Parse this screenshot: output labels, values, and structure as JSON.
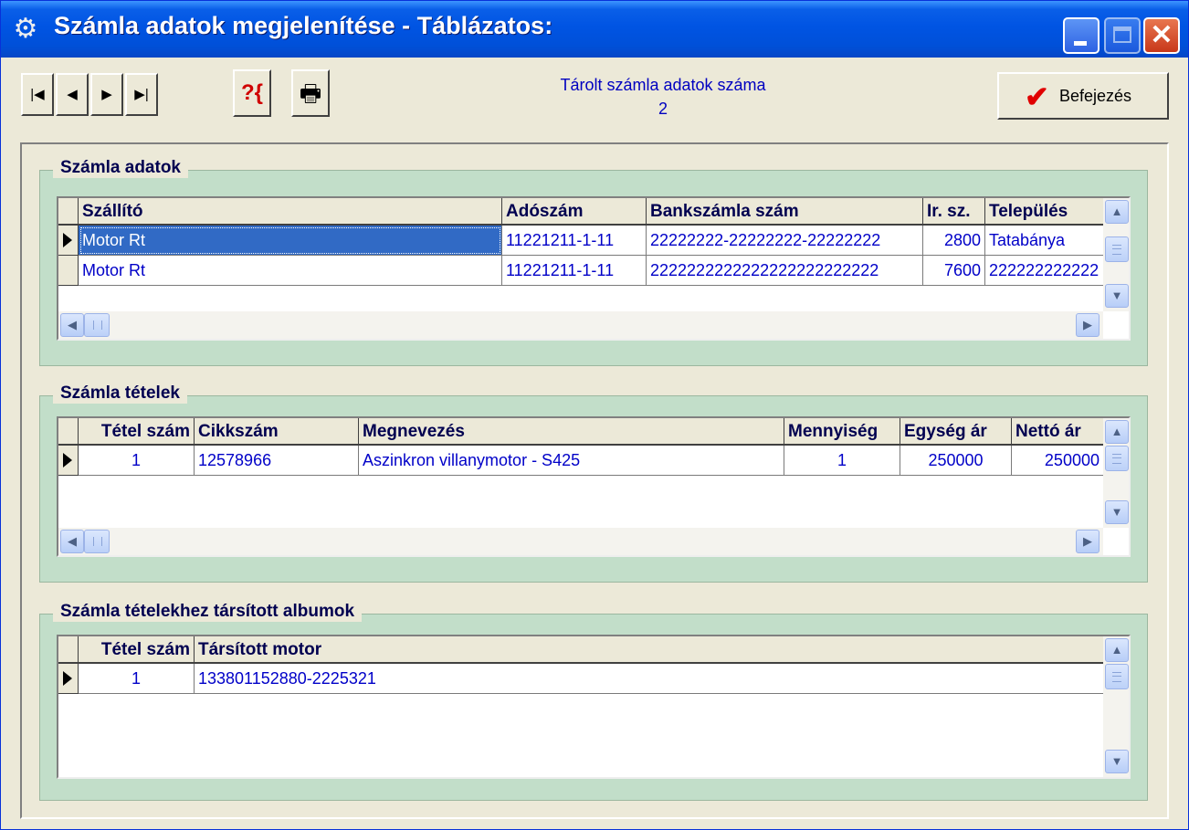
{
  "window": {
    "title": "Számla adatok megjelenítése - Táblázatos:",
    "icon": "gear-icon"
  },
  "toolbar": {
    "first_glyph": "|◀",
    "prev_glyph": "◀",
    "next_glyph": "▶",
    "last_glyph": "▶|",
    "filter_glyph": "?{",
    "print_glyph": "🖶",
    "count_label": "Tárolt számla adatok száma",
    "count_value": "2",
    "finish_label": "Befejezés",
    "finish_icon": "checkmark-icon"
  },
  "invoices": {
    "title": "Számla adatok",
    "columns": [
      "Szállító",
      "Adószám",
      "Bankszámla szám",
      "Ir. sz.",
      "Település"
    ],
    "rows": [
      [
        "Motor Rt",
        "11221211-1-11",
        "22222222-22222222-22222222",
        "2800",
        "Tatabánya"
      ],
      [
        "Motor Rt",
        "11221211-1-11",
        "2222222222222222222222222",
        "7600",
        "222222222222"
      ]
    ]
  },
  "items": {
    "title": "Számla tételek",
    "columns": [
      "Tétel szám",
      "Cikkszám",
      "Megnevezés",
      "Mennyiség",
      "Egység ár",
      "Nettó ár"
    ],
    "rows": [
      [
        "1",
        "12578966",
        "Aszinkron villanymotor - S425",
        "1",
        "250000",
        "250000"
      ]
    ]
  },
  "albums": {
    "title": "Számla tételekhez társított albumok",
    "columns": [
      "Tétel szám",
      "Társított motor"
    ],
    "rows": [
      [
        "1",
        "133801152880-2225321"
      ]
    ]
  },
  "colors": {
    "titlebar": "#0054e3",
    "group_bg": "#c2dec9",
    "cell_text": "#0000c8",
    "selection": "#316ac5"
  }
}
